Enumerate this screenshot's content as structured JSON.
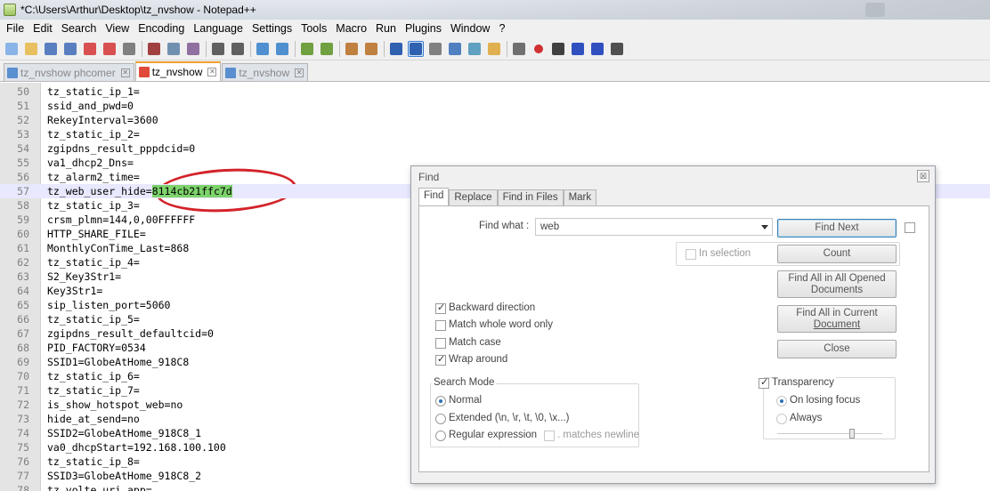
{
  "window": {
    "title": "*C:\\Users\\Arthur\\Desktop\\tz_nvshow - Notepad++"
  },
  "menu": [
    "File",
    "Edit",
    "Search",
    "View",
    "Encoding",
    "Language",
    "Settings",
    "Tools",
    "Macro",
    "Run",
    "Plugins",
    "Window",
    "?"
  ],
  "toolbar_icons": [
    "new-file-icon",
    "open-file-icon",
    "save-icon",
    "save-all-icon",
    "close-icon",
    "close-all-icon",
    "print-icon",
    "cut-icon",
    "copy-icon",
    "paste-icon",
    "undo-icon",
    "redo-icon",
    "find-icon",
    "replace-icon",
    "zoom-in-icon",
    "zoom-out-icon",
    "sync-vertical-icon",
    "sync-horizontal-icon",
    "wrap-icon",
    "show-all-chars-icon",
    "indent-guide-icon",
    "doc-map-icon",
    "function-list-icon",
    "folder-workspace-icon",
    "monitoring-icon",
    "record-macro-icon",
    "stop-macro-icon",
    "play-macro-icon",
    "run-macro-multiple-icon",
    "save-macro-icon"
  ],
  "tabs": [
    {
      "label": "tz_nvshow phcomer",
      "active": false
    },
    {
      "label": "tz_nvshow",
      "active": true
    },
    {
      "label": "tz_nvshow",
      "active": false
    }
  ],
  "editor": {
    "lines": [
      {
        "n": "50",
        "text": "tz_static_ip_1="
      },
      {
        "n": "51",
        "text": "ssid_and_pwd=0"
      },
      {
        "n": "52",
        "text": "RekeyInterval=3600"
      },
      {
        "n": "53",
        "text": "tz_static_ip_2="
      },
      {
        "n": "54",
        "text": "zgipdns_result_pppdcid=0"
      },
      {
        "n": "55",
        "text": "va1_dhcp2_Dns="
      },
      {
        "n": "56",
        "text": "tz_alarm2_time="
      },
      {
        "n": "57",
        "text": "tz_web_user_hide=",
        "selected": "8114cb21ffc7d"
      },
      {
        "n": "58",
        "text": "tz_static_ip_3="
      },
      {
        "n": "59",
        "text": "crsm_plmn=144,0,00FFFFFF"
      },
      {
        "n": "60",
        "text": "HTTP_SHARE_FILE="
      },
      {
        "n": "61",
        "text": "MonthlyConTime_Last=868"
      },
      {
        "n": "62",
        "text": "tz_static_ip_4="
      },
      {
        "n": "63",
        "text": "S2_Key3Str1="
      },
      {
        "n": "64",
        "text": "Key3Str1="
      },
      {
        "n": "65",
        "text": "sip_listen_port=5060"
      },
      {
        "n": "66",
        "text": "tz_static_ip_5="
      },
      {
        "n": "67",
        "text": "zgipdns_result_defaultcid=0"
      },
      {
        "n": "68",
        "text": "PID_FACTORY=0534"
      },
      {
        "n": "69",
        "text": "SSID1=GlobeAtHome_918C8"
      },
      {
        "n": "70",
        "text": "tz_static_ip_6="
      },
      {
        "n": "71",
        "text": "tz_static_ip_7="
      },
      {
        "n": "72",
        "text": "is_show_hotspot_web=no"
      },
      {
        "n": "73",
        "text": "hide_at_send=no"
      },
      {
        "n": "74",
        "text": "SSID2=GlobeAtHome_918C8_1"
      },
      {
        "n": "75",
        "text": "va0_dhcpStart=192.168.100.100"
      },
      {
        "n": "76",
        "text": "tz_static_ip_8="
      },
      {
        "n": "77",
        "text": "SSID3=GlobeAtHome_918C8_2"
      },
      {
        "n": "78",
        "text": "tz_volte_uri_app="
      }
    ]
  },
  "find_dialog": {
    "title": "Find",
    "close": "☒",
    "tabs": [
      "Find",
      "Replace",
      "Find in Files",
      "Mark"
    ],
    "find_what_label": "Find what :",
    "find_what_value": "web",
    "in_selection": "In selection",
    "buttons": {
      "find_next": "Find Next",
      "count": "Count",
      "find_all_opened_1": "Find All in All Opened",
      "find_all_opened_2": "Documents",
      "find_all_current_1": "Find All in Current",
      "find_all_current_2": "Document",
      "close": "Close"
    },
    "options": {
      "backward": "Backward direction",
      "whole_word": "Match whole word only",
      "match_case": "Match case",
      "wrap": "Wrap around"
    },
    "search_mode": {
      "title": "Search Mode",
      "normal": "Normal",
      "extended": "Extended (\\n, \\r, \\t, \\0, \\x...)",
      "regex": "Regular expression",
      "matches_newline": ". matches newline"
    },
    "transparency": {
      "title": "Transparency",
      "on_losing_focus": "On losing focus",
      "always": "Always"
    }
  }
}
